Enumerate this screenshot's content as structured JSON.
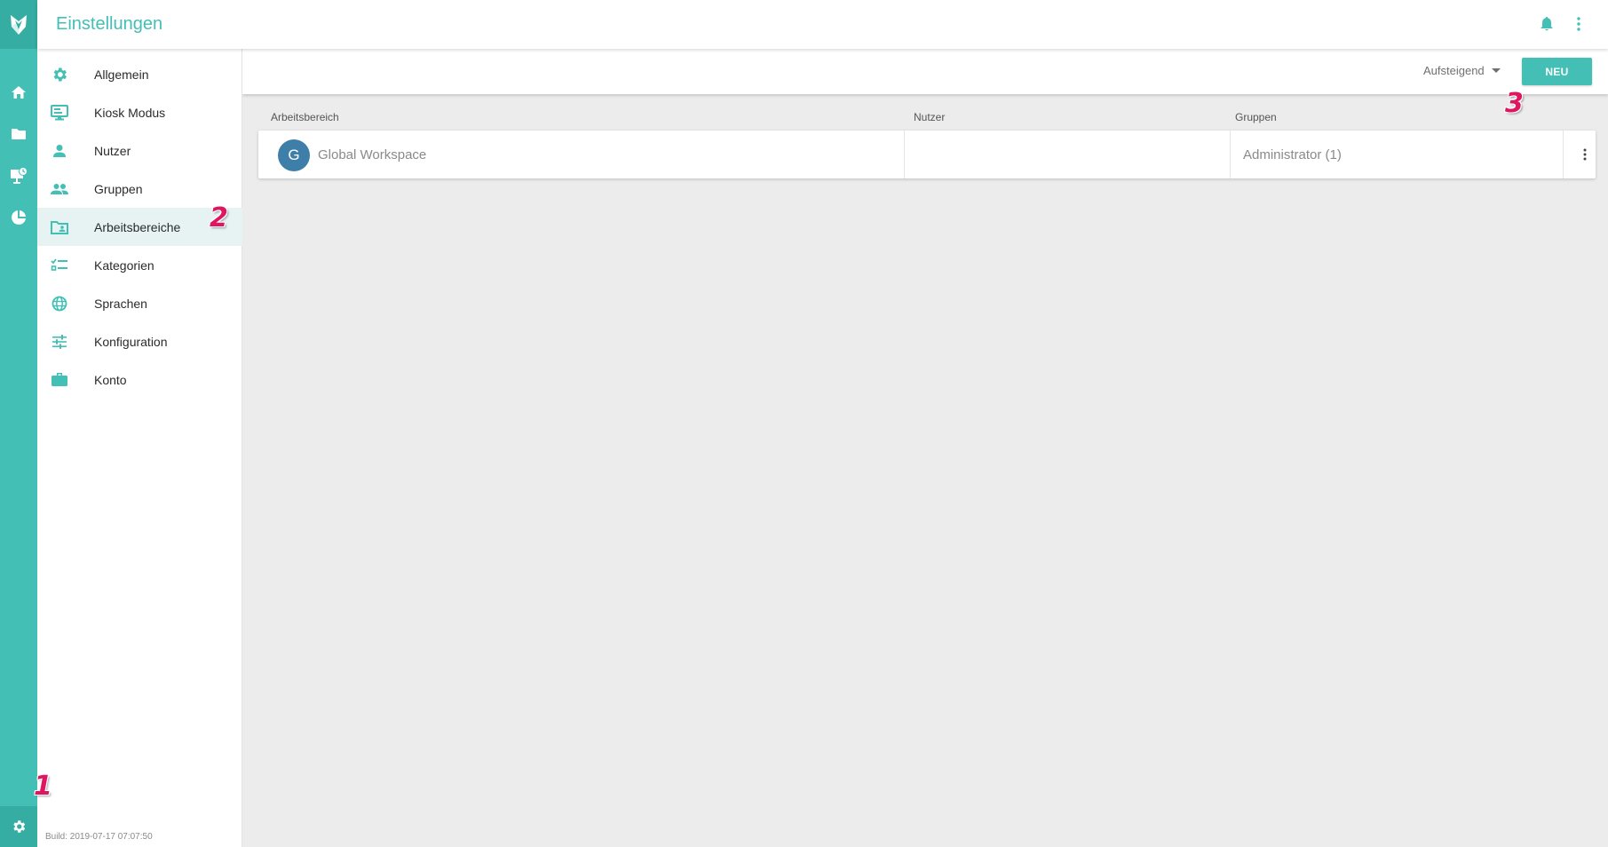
{
  "header": {
    "title": "Einstellungen"
  },
  "menu": {
    "items": [
      {
        "label": "Allgemein",
        "icon": "gear-icon"
      },
      {
        "label": "Kiosk Modus",
        "icon": "monitor-icon"
      },
      {
        "label": "Nutzer",
        "icon": "person-icon"
      },
      {
        "label": "Gruppen",
        "icon": "people-icon"
      },
      {
        "label": "Arbeitsbereiche",
        "icon": "workspace-icon",
        "active": true
      },
      {
        "label": "Kategorien",
        "icon": "checklist-icon"
      },
      {
        "label": "Sprachen",
        "icon": "globe-icon"
      },
      {
        "label": "Konfiguration",
        "icon": "sliders-icon"
      },
      {
        "label": "Konto",
        "icon": "briefcase-icon"
      }
    ],
    "build": "Build: 2019-07-17 07:07:50"
  },
  "rail": {
    "icons": [
      "home-icon",
      "folder-icon",
      "presentation-icon",
      "pie-chart-icon"
    ],
    "bottom_icon": "gear-icon"
  },
  "toolbar": {
    "sort_label": "Aufsteigend",
    "new_label": "NEU"
  },
  "table": {
    "columns": [
      "Arbeitsbereich",
      "Nutzer",
      "Gruppen"
    ],
    "rows": [
      {
        "avatar": "G",
        "name": "Global Workspace",
        "users": "",
        "groups": "Administrator (1)"
      }
    ]
  },
  "annotations": [
    "1",
    "2",
    "3"
  ],
  "colors": {
    "accent": "#43bfb5",
    "accent_dark": "#36ada3",
    "avatar": "#3d7fa8",
    "annotation": "#e01560",
    "active_bg": "#e6f3f2"
  }
}
